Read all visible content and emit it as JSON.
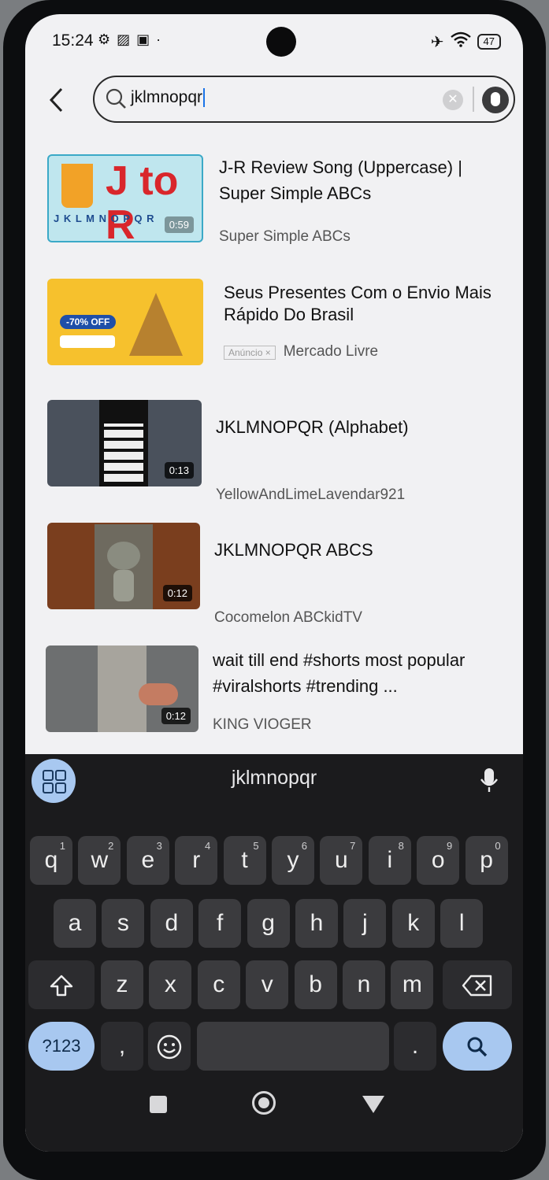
{
  "status_bar": {
    "time": "15:24",
    "battery": "47",
    "icons": [
      "gear-icon",
      "photo-icon",
      "notification-icon",
      "dot-icon",
      "airplane-icon",
      "wifi-icon",
      "battery-icon"
    ]
  },
  "search": {
    "query": "jklmnopqr",
    "back_icon": "chevron-left-icon",
    "clear_icon": "clear-icon",
    "mic_icon": "mic-icon"
  },
  "results": [
    {
      "title": "J-R Review Song (Uppercase) | Super Simple ABCs",
      "channel": "Super Simple ABCs",
      "duration": "0:59",
      "thumb_text": "J to R",
      "thumb_letters": "J K L M N O P Q R"
    },
    {
      "title": "Seus Presentes Com o Envio Mais Rápido Do Brasil",
      "ad_label": "Anúncio ×",
      "channel": "Mercado Livre",
      "thumb_text": "-70% OFF"
    },
    {
      "title": "JKLMNOPQR (Alphabet)",
      "channel": "YellowAndLimeLavendar921",
      "duration": "0:13"
    },
    {
      "title": "JKLMNOPQR ABCS",
      "channel": "Cocomelon ABCkidTV",
      "duration": "0:12"
    },
    {
      "title": "wait till end #shorts most popular #viralshorts #trending ...",
      "channel": "KING VIOGER",
      "duration": "0:12"
    }
  ],
  "keyboard": {
    "suggestion": "jklmnopqr",
    "row1": [
      {
        "k": "q",
        "n": "1"
      },
      {
        "k": "w",
        "n": "2"
      },
      {
        "k": "e",
        "n": "3"
      },
      {
        "k": "r",
        "n": "4"
      },
      {
        "k": "t",
        "n": "5"
      },
      {
        "k": "y",
        "n": "6"
      },
      {
        "k": "u",
        "n": "7"
      },
      {
        "k": "i",
        "n": "8"
      },
      {
        "k": "o",
        "n": "9"
      },
      {
        "k": "p",
        "n": "0"
      }
    ],
    "row2": [
      "a",
      "s",
      "d",
      "f",
      "g",
      "h",
      "j",
      "k",
      "l"
    ],
    "row3": [
      "z",
      "x",
      "c",
      "v",
      "b",
      "n",
      "m"
    ],
    "symbols_label": "?123",
    "comma": ",",
    "period": "."
  },
  "colors": {
    "accent": "#a8c8f0",
    "key_bg": "#3b3b3e",
    "keyboard_bg": "#1b1b1d"
  }
}
